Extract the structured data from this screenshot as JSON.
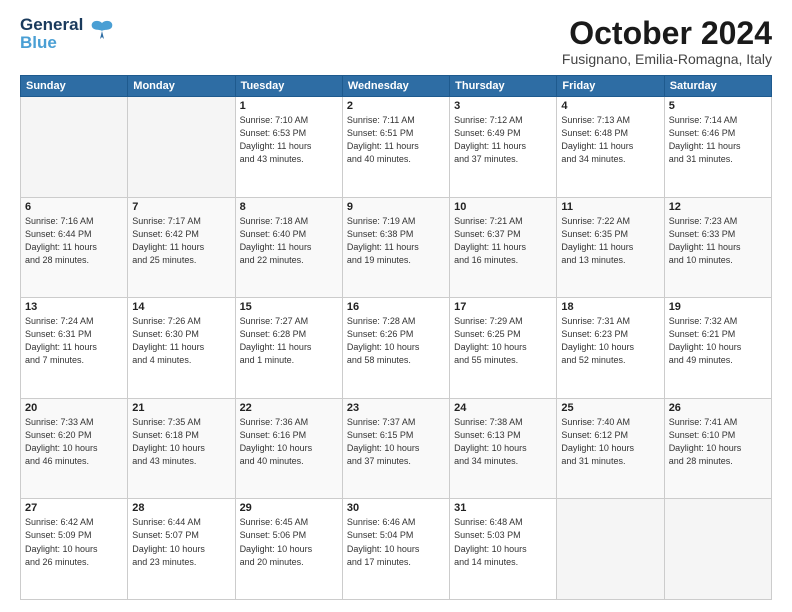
{
  "header": {
    "logo_line1": "General",
    "logo_line2": "Blue",
    "month": "October 2024",
    "location": "Fusignano, Emilia-Romagna, Italy"
  },
  "days_of_week": [
    "Sunday",
    "Monday",
    "Tuesday",
    "Wednesday",
    "Thursday",
    "Friday",
    "Saturday"
  ],
  "weeks": [
    [
      {
        "day": "",
        "info": ""
      },
      {
        "day": "",
        "info": ""
      },
      {
        "day": "1",
        "info": "Sunrise: 7:10 AM\nSunset: 6:53 PM\nDaylight: 11 hours\nand 43 minutes."
      },
      {
        "day": "2",
        "info": "Sunrise: 7:11 AM\nSunset: 6:51 PM\nDaylight: 11 hours\nand 40 minutes."
      },
      {
        "day": "3",
        "info": "Sunrise: 7:12 AM\nSunset: 6:49 PM\nDaylight: 11 hours\nand 37 minutes."
      },
      {
        "day": "4",
        "info": "Sunrise: 7:13 AM\nSunset: 6:48 PM\nDaylight: 11 hours\nand 34 minutes."
      },
      {
        "day": "5",
        "info": "Sunrise: 7:14 AM\nSunset: 6:46 PM\nDaylight: 11 hours\nand 31 minutes."
      }
    ],
    [
      {
        "day": "6",
        "info": "Sunrise: 7:16 AM\nSunset: 6:44 PM\nDaylight: 11 hours\nand 28 minutes."
      },
      {
        "day": "7",
        "info": "Sunrise: 7:17 AM\nSunset: 6:42 PM\nDaylight: 11 hours\nand 25 minutes."
      },
      {
        "day": "8",
        "info": "Sunrise: 7:18 AM\nSunset: 6:40 PM\nDaylight: 11 hours\nand 22 minutes."
      },
      {
        "day": "9",
        "info": "Sunrise: 7:19 AM\nSunset: 6:38 PM\nDaylight: 11 hours\nand 19 minutes."
      },
      {
        "day": "10",
        "info": "Sunrise: 7:21 AM\nSunset: 6:37 PM\nDaylight: 11 hours\nand 16 minutes."
      },
      {
        "day": "11",
        "info": "Sunrise: 7:22 AM\nSunset: 6:35 PM\nDaylight: 11 hours\nand 13 minutes."
      },
      {
        "day": "12",
        "info": "Sunrise: 7:23 AM\nSunset: 6:33 PM\nDaylight: 11 hours\nand 10 minutes."
      }
    ],
    [
      {
        "day": "13",
        "info": "Sunrise: 7:24 AM\nSunset: 6:31 PM\nDaylight: 11 hours\nand 7 minutes."
      },
      {
        "day": "14",
        "info": "Sunrise: 7:26 AM\nSunset: 6:30 PM\nDaylight: 11 hours\nand 4 minutes."
      },
      {
        "day": "15",
        "info": "Sunrise: 7:27 AM\nSunset: 6:28 PM\nDaylight: 11 hours\nand 1 minute."
      },
      {
        "day": "16",
        "info": "Sunrise: 7:28 AM\nSunset: 6:26 PM\nDaylight: 10 hours\nand 58 minutes."
      },
      {
        "day": "17",
        "info": "Sunrise: 7:29 AM\nSunset: 6:25 PM\nDaylight: 10 hours\nand 55 minutes."
      },
      {
        "day": "18",
        "info": "Sunrise: 7:31 AM\nSunset: 6:23 PM\nDaylight: 10 hours\nand 52 minutes."
      },
      {
        "day": "19",
        "info": "Sunrise: 7:32 AM\nSunset: 6:21 PM\nDaylight: 10 hours\nand 49 minutes."
      }
    ],
    [
      {
        "day": "20",
        "info": "Sunrise: 7:33 AM\nSunset: 6:20 PM\nDaylight: 10 hours\nand 46 minutes."
      },
      {
        "day": "21",
        "info": "Sunrise: 7:35 AM\nSunset: 6:18 PM\nDaylight: 10 hours\nand 43 minutes."
      },
      {
        "day": "22",
        "info": "Sunrise: 7:36 AM\nSunset: 6:16 PM\nDaylight: 10 hours\nand 40 minutes."
      },
      {
        "day": "23",
        "info": "Sunrise: 7:37 AM\nSunset: 6:15 PM\nDaylight: 10 hours\nand 37 minutes."
      },
      {
        "day": "24",
        "info": "Sunrise: 7:38 AM\nSunset: 6:13 PM\nDaylight: 10 hours\nand 34 minutes."
      },
      {
        "day": "25",
        "info": "Sunrise: 7:40 AM\nSunset: 6:12 PM\nDaylight: 10 hours\nand 31 minutes."
      },
      {
        "day": "26",
        "info": "Sunrise: 7:41 AM\nSunset: 6:10 PM\nDaylight: 10 hours\nand 28 minutes."
      }
    ],
    [
      {
        "day": "27",
        "info": "Sunrise: 6:42 AM\nSunset: 5:09 PM\nDaylight: 10 hours\nand 26 minutes."
      },
      {
        "day": "28",
        "info": "Sunrise: 6:44 AM\nSunset: 5:07 PM\nDaylight: 10 hours\nand 23 minutes."
      },
      {
        "day": "29",
        "info": "Sunrise: 6:45 AM\nSunset: 5:06 PM\nDaylight: 10 hours\nand 20 minutes."
      },
      {
        "day": "30",
        "info": "Sunrise: 6:46 AM\nSunset: 5:04 PM\nDaylight: 10 hours\nand 17 minutes."
      },
      {
        "day": "31",
        "info": "Sunrise: 6:48 AM\nSunset: 5:03 PM\nDaylight: 10 hours\nand 14 minutes."
      },
      {
        "day": "",
        "info": ""
      },
      {
        "day": "",
        "info": ""
      }
    ]
  ]
}
